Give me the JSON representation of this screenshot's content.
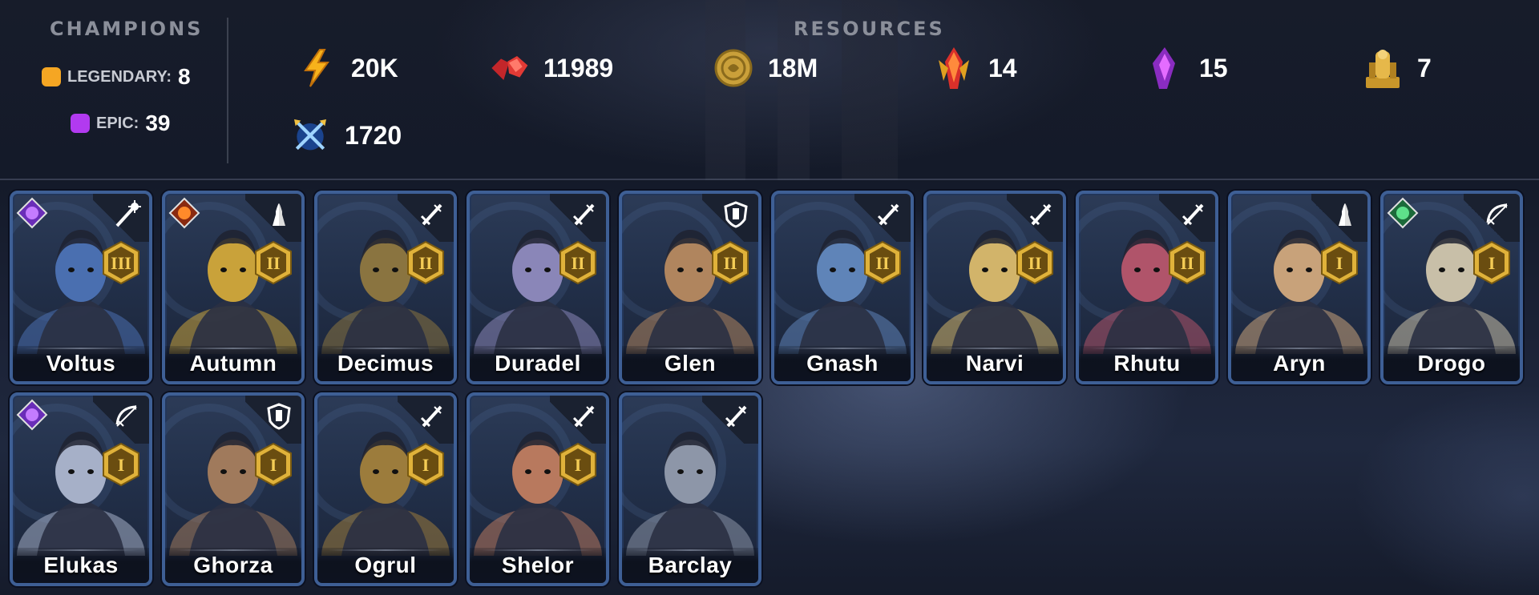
{
  "champions_summary": {
    "title": "CHAMPIONS",
    "legendary": {
      "label": "LEGENDARY:",
      "count": "8",
      "color": "#f5a623"
    },
    "epic": {
      "label": "EPIC:",
      "count": "39",
      "color": "#b23af0"
    }
  },
  "resources": {
    "title": "RESOURCES",
    "items": [
      {
        "icon": "energy-bolt-icon",
        "value": "20K"
      },
      {
        "icon": "gem-icon",
        "value": "11989"
      },
      {
        "icon": "silver-coin-icon",
        "value": "18M"
      },
      {
        "icon": "fire-shard-icon",
        "value": "14"
      },
      {
        "icon": "void-shard-icon",
        "value": "15"
      },
      {
        "icon": "gold-statue-icon",
        "value": "7"
      },
      {
        "icon": "arena-token-icon",
        "value": "1720"
      }
    ]
  },
  "champions": [
    {
      "name": "Voltus",
      "role": "magic-staff-icon",
      "rank": "III",
      "affinity": "void",
      "rarity_color": "#f5a623",
      "skin": "#4a6fb0"
    },
    {
      "name": "Autumn",
      "role": "support-hands-icon",
      "rank": "II",
      "affinity": "fire",
      "rarity_color": "#f5a623",
      "skin": "#c9a23a"
    },
    {
      "name": "Decimus",
      "role": "attack-sword-icon",
      "rank": "II",
      "affinity": "",
      "rarity_color": "#b23af0",
      "skin": "#8a7440"
    },
    {
      "name": "Duradel",
      "role": "attack-sword-icon",
      "rank": "II",
      "affinity": "",
      "rarity_color": "#b23af0",
      "skin": "#8a86b8"
    },
    {
      "name": "Glen",
      "role": "defense-shield-icon",
      "rank": "II",
      "affinity": "",
      "rarity_color": "#b23af0",
      "skin": "#b0855e"
    },
    {
      "name": "Gnash",
      "role": "attack-sword-icon",
      "rank": "II",
      "affinity": "",
      "rarity_color": "#b23af0",
      "skin": "#5f84b8"
    },
    {
      "name": "Narvi",
      "role": "attack-sword-icon",
      "rank": "II",
      "affinity": "",
      "rarity_color": "#b23af0",
      "skin": "#d2b46a"
    },
    {
      "name": "Rhutu",
      "role": "attack-sword-icon",
      "rank": "II",
      "affinity": "",
      "rarity_color": "#b23af0",
      "skin": "#b0546a"
    },
    {
      "name": "Aryn",
      "role": "support-hands-icon",
      "rank": "I",
      "affinity": "",
      "rarity_color": "#b23af0",
      "skin": "#c8a27a"
    },
    {
      "name": "Drogo",
      "role": "ranged-bow-icon",
      "rank": "I",
      "affinity": "nature",
      "rarity_color": "#b23af0",
      "skin": "#c8bfa8"
    },
    {
      "name": "Elukas",
      "role": "ranged-bow-icon",
      "rank": "I",
      "affinity": "void",
      "rarity_color": "#b23af0",
      "skin": "#a6b0c8"
    },
    {
      "name": "Ghorza",
      "role": "defense-shield-icon",
      "rank": "I",
      "affinity": "",
      "rarity_color": "#b23af0",
      "skin": "#a07a5c"
    },
    {
      "name": "Ogrul",
      "role": "attack-sword-icon",
      "rank": "I",
      "affinity": "",
      "rarity_color": "#b23af0",
      "skin": "#9c7c3c"
    },
    {
      "name": "Shelor",
      "role": "attack-sword-icon",
      "rank": "I",
      "affinity": "",
      "rarity_color": "#b23af0",
      "skin": "#b8795e"
    },
    {
      "name": "Barclay",
      "role": "attack-sword-icon",
      "rank": "",
      "affinity": "",
      "rarity_color": "#b23af0",
      "skin": "#8d96a8"
    }
  ]
}
